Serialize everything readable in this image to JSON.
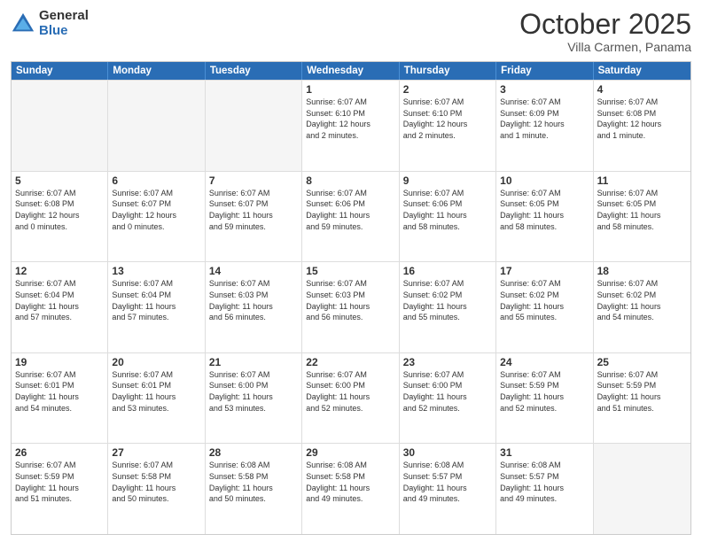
{
  "logo": {
    "general": "General",
    "blue": "Blue"
  },
  "title": "October 2025",
  "subtitle": "Villa Carmen, Panama",
  "days": [
    "Sunday",
    "Monday",
    "Tuesday",
    "Wednesday",
    "Thursday",
    "Friday",
    "Saturday"
  ],
  "weeks": [
    [
      {
        "day": "",
        "info": ""
      },
      {
        "day": "",
        "info": ""
      },
      {
        "day": "",
        "info": ""
      },
      {
        "day": "1",
        "info": "Sunrise: 6:07 AM\nSunset: 6:10 PM\nDaylight: 12 hours\nand 2 minutes."
      },
      {
        "day": "2",
        "info": "Sunrise: 6:07 AM\nSunset: 6:10 PM\nDaylight: 12 hours\nand 2 minutes."
      },
      {
        "day": "3",
        "info": "Sunrise: 6:07 AM\nSunset: 6:09 PM\nDaylight: 12 hours\nand 1 minute."
      },
      {
        "day": "4",
        "info": "Sunrise: 6:07 AM\nSunset: 6:08 PM\nDaylight: 12 hours\nand 1 minute."
      }
    ],
    [
      {
        "day": "5",
        "info": "Sunrise: 6:07 AM\nSunset: 6:08 PM\nDaylight: 12 hours\nand 0 minutes."
      },
      {
        "day": "6",
        "info": "Sunrise: 6:07 AM\nSunset: 6:07 PM\nDaylight: 12 hours\nand 0 minutes."
      },
      {
        "day": "7",
        "info": "Sunrise: 6:07 AM\nSunset: 6:07 PM\nDaylight: 11 hours\nand 59 minutes."
      },
      {
        "day": "8",
        "info": "Sunrise: 6:07 AM\nSunset: 6:06 PM\nDaylight: 11 hours\nand 59 minutes."
      },
      {
        "day": "9",
        "info": "Sunrise: 6:07 AM\nSunset: 6:06 PM\nDaylight: 11 hours\nand 58 minutes."
      },
      {
        "day": "10",
        "info": "Sunrise: 6:07 AM\nSunset: 6:05 PM\nDaylight: 11 hours\nand 58 minutes."
      },
      {
        "day": "11",
        "info": "Sunrise: 6:07 AM\nSunset: 6:05 PM\nDaylight: 11 hours\nand 58 minutes."
      }
    ],
    [
      {
        "day": "12",
        "info": "Sunrise: 6:07 AM\nSunset: 6:04 PM\nDaylight: 11 hours\nand 57 minutes."
      },
      {
        "day": "13",
        "info": "Sunrise: 6:07 AM\nSunset: 6:04 PM\nDaylight: 11 hours\nand 57 minutes."
      },
      {
        "day": "14",
        "info": "Sunrise: 6:07 AM\nSunset: 6:03 PM\nDaylight: 11 hours\nand 56 minutes."
      },
      {
        "day": "15",
        "info": "Sunrise: 6:07 AM\nSunset: 6:03 PM\nDaylight: 11 hours\nand 56 minutes."
      },
      {
        "day": "16",
        "info": "Sunrise: 6:07 AM\nSunset: 6:02 PM\nDaylight: 11 hours\nand 55 minutes."
      },
      {
        "day": "17",
        "info": "Sunrise: 6:07 AM\nSunset: 6:02 PM\nDaylight: 11 hours\nand 55 minutes."
      },
      {
        "day": "18",
        "info": "Sunrise: 6:07 AM\nSunset: 6:02 PM\nDaylight: 11 hours\nand 54 minutes."
      }
    ],
    [
      {
        "day": "19",
        "info": "Sunrise: 6:07 AM\nSunset: 6:01 PM\nDaylight: 11 hours\nand 54 minutes."
      },
      {
        "day": "20",
        "info": "Sunrise: 6:07 AM\nSunset: 6:01 PM\nDaylight: 11 hours\nand 53 minutes."
      },
      {
        "day": "21",
        "info": "Sunrise: 6:07 AM\nSunset: 6:00 PM\nDaylight: 11 hours\nand 53 minutes."
      },
      {
        "day": "22",
        "info": "Sunrise: 6:07 AM\nSunset: 6:00 PM\nDaylight: 11 hours\nand 52 minutes."
      },
      {
        "day": "23",
        "info": "Sunrise: 6:07 AM\nSunset: 6:00 PM\nDaylight: 11 hours\nand 52 minutes."
      },
      {
        "day": "24",
        "info": "Sunrise: 6:07 AM\nSunset: 5:59 PM\nDaylight: 11 hours\nand 52 minutes."
      },
      {
        "day": "25",
        "info": "Sunrise: 6:07 AM\nSunset: 5:59 PM\nDaylight: 11 hours\nand 51 minutes."
      }
    ],
    [
      {
        "day": "26",
        "info": "Sunrise: 6:07 AM\nSunset: 5:59 PM\nDaylight: 11 hours\nand 51 minutes."
      },
      {
        "day": "27",
        "info": "Sunrise: 6:07 AM\nSunset: 5:58 PM\nDaylight: 11 hours\nand 50 minutes."
      },
      {
        "day": "28",
        "info": "Sunrise: 6:08 AM\nSunset: 5:58 PM\nDaylight: 11 hours\nand 50 minutes."
      },
      {
        "day": "29",
        "info": "Sunrise: 6:08 AM\nSunset: 5:58 PM\nDaylight: 11 hours\nand 49 minutes."
      },
      {
        "day": "30",
        "info": "Sunrise: 6:08 AM\nSunset: 5:57 PM\nDaylight: 11 hours\nand 49 minutes."
      },
      {
        "day": "31",
        "info": "Sunrise: 6:08 AM\nSunset: 5:57 PM\nDaylight: 11 hours\nand 49 minutes."
      },
      {
        "day": "",
        "info": ""
      }
    ]
  ]
}
